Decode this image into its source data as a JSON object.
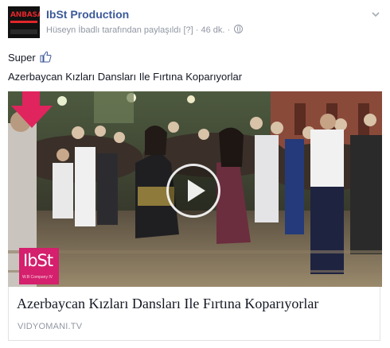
{
  "post": {
    "page_name": "IbSt Production",
    "avatar_text": "ANBASA",
    "meta": {
      "shared_by": "Hüseyn İbadlı tarafından paylaşıldı",
      "help": "[?]",
      "separator": "·",
      "time": "46 dk.",
      "separator2": "·",
      "privacy_icon": "globe-icon"
    },
    "options_icon": "chevron-down-icon",
    "message_line1": "Super",
    "message_icon": "thumbs-up-icon",
    "message_line2": "Azerbaycan Kızları Dansları Ile Fırtına Koparıyorlar",
    "video": {
      "play_icon": "play-icon",
      "watermark": "IbSt",
      "watermark_sub": "W.B Company IV",
      "overlay_arrow_color": "#e0245e"
    },
    "link_preview": {
      "title": "Azerbaycan Kızları Dansları Ile Fırtına Koparıyorlar",
      "source": "VIDYOMANI.TV"
    }
  },
  "colors": {
    "link_blue": "#3b5998",
    "meta_gray": "#9197a3",
    "text": "#141823",
    "brand_pink": "#d4206d"
  }
}
